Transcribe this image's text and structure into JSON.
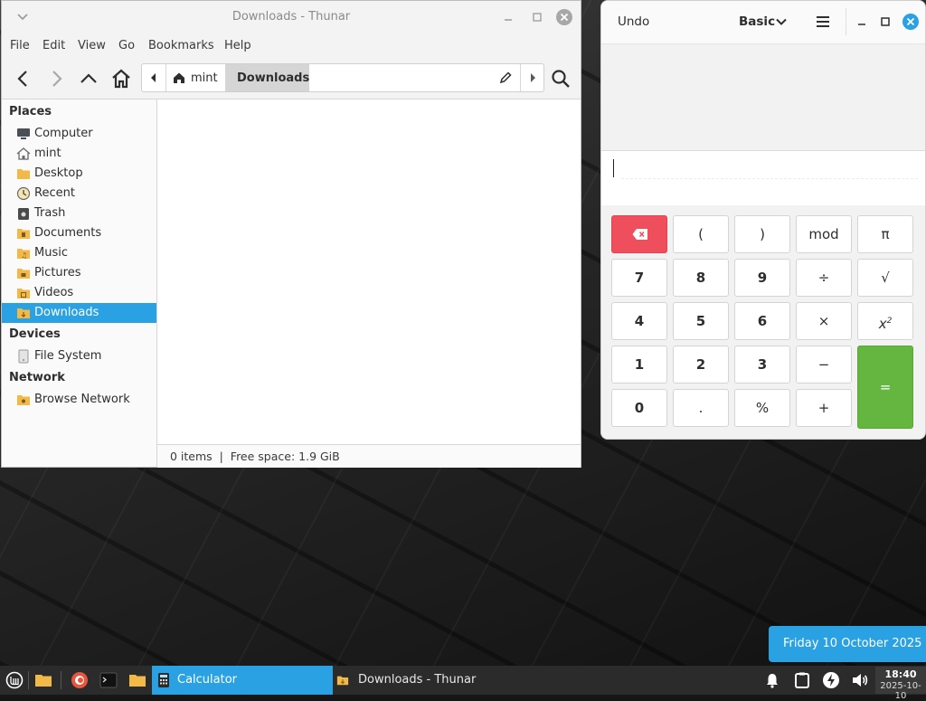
{
  "thunar": {
    "title": "Downloads - Thunar",
    "menu": [
      "File",
      "Edit",
      "View",
      "Go",
      "Bookmarks",
      "Help"
    ],
    "path": {
      "home": "mint",
      "current": "Downloads"
    },
    "sidebar": {
      "places_heading": "Places",
      "places": [
        {
          "label": "Computer",
          "icon": "computer-icon"
        },
        {
          "label": "mint",
          "icon": "home-icon"
        },
        {
          "label": "Desktop",
          "icon": "desktop-folder-icon"
        },
        {
          "label": "Recent",
          "icon": "recent-clock-icon"
        },
        {
          "label": "Trash",
          "icon": "trash-icon"
        },
        {
          "label": "Documents",
          "icon": "documents-folder-icon"
        },
        {
          "label": "Music",
          "icon": "music-folder-icon"
        },
        {
          "label": "Pictures",
          "icon": "pictures-folder-icon"
        },
        {
          "label": "Videos",
          "icon": "videos-folder-icon"
        },
        {
          "label": "Downloads",
          "icon": "downloads-folder-icon",
          "active": true
        }
      ],
      "devices_heading": "Devices",
      "devices": [
        {
          "label": "File System",
          "icon": "drive-icon"
        }
      ],
      "network_heading": "Network",
      "network": [
        {
          "label": "Browse Network",
          "icon": "network-folder-icon"
        }
      ]
    },
    "status": "0 items  |  Free space: 1.9 GiB"
  },
  "calculator": {
    "undo_label": "Undo",
    "mode_label": "Basic",
    "keys": {
      "open_paren": "(",
      "close_paren": ")",
      "mod": "mod",
      "pi": "π",
      "k7": "7",
      "k8": "8",
      "k9": "9",
      "divide": "÷",
      "sqrt": "√",
      "k4": "4",
      "k5": "5",
      "k6": "6",
      "multiply": "×",
      "square_base": "x",
      "square_exp": "2",
      "k1": "1",
      "k2": "2",
      "k3": "3",
      "subtract": "−",
      "k0": "0",
      "decimal": ".",
      "percent": "%",
      "add": "+",
      "equals": "="
    }
  },
  "date_popup": "Friday 10 October 2025",
  "taskbar": {
    "calculator_task": "Calculator",
    "thunar_task": "Downloads - Thunar",
    "time": "18:40",
    "date": "2025-10-10"
  },
  "colors": {
    "accent": "#2aa1e3",
    "backspace": "#ef4f5c",
    "equals": "#65b541"
  }
}
